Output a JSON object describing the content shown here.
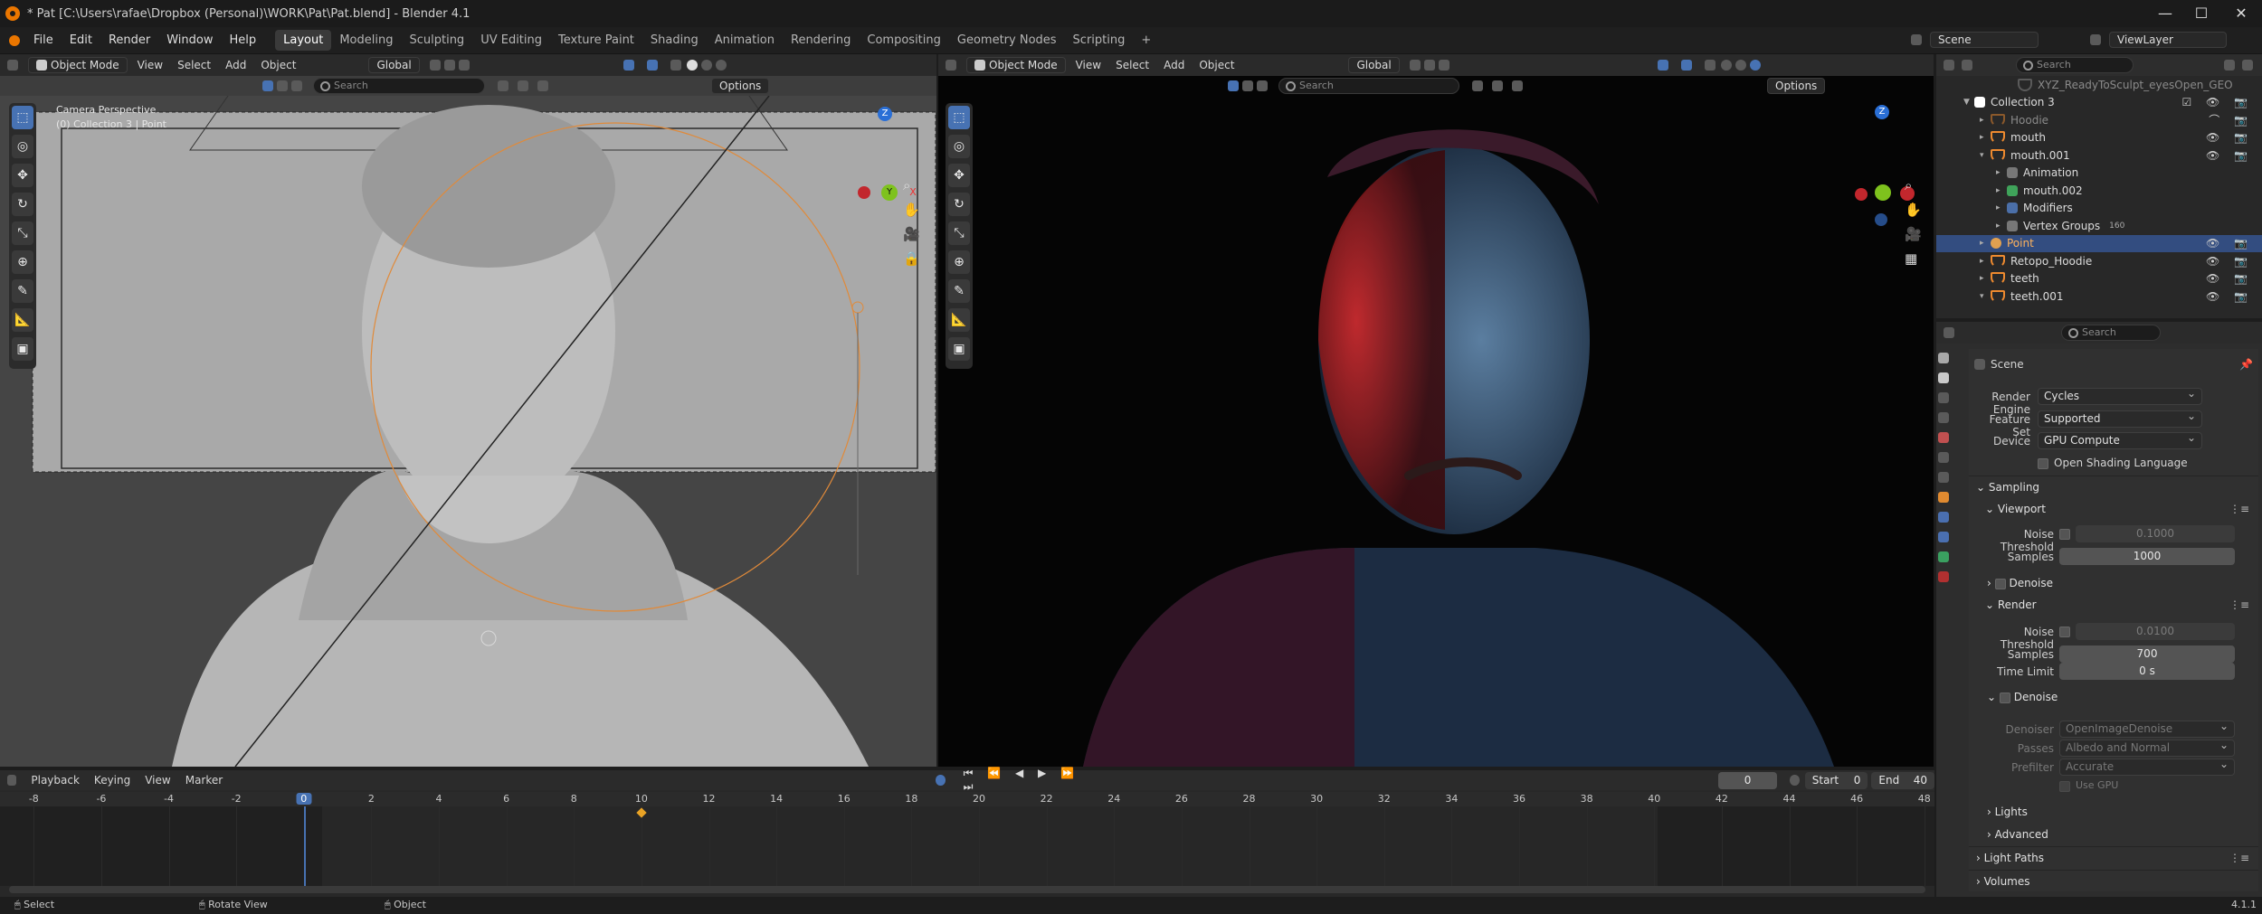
{
  "title_bar": {
    "title": "* Pat [C:\\Users\\rafae\\Dropbox (Personal)\\WORK\\Pat\\Pat.blend] - Blender 4.1",
    "minimize": "—",
    "maximize": "☐",
    "close": "✕"
  },
  "menu": [
    "File",
    "Edit",
    "Render",
    "Window",
    "Help"
  ],
  "workspaces": [
    "Layout",
    "Modeling",
    "Sculpting",
    "UV Editing",
    "Texture Paint",
    "Shading",
    "Animation",
    "Rendering",
    "Compositing",
    "Geometry Nodes",
    "Scripting"
  ],
  "active_workspace": "Layout",
  "scene": {
    "scene_name": "Scene",
    "view_layer": "ViewLayer"
  },
  "viewport_left": {
    "mode": "Object Mode",
    "menus": [
      "View",
      "Select",
      "Add",
      "Object"
    ],
    "orientation": "Global",
    "search_placeholder": "Search",
    "options": "Options",
    "overlay_line1": "Camera Perspective",
    "overlay_line2": "(0) Collection 3 | Point",
    "gizmo": {
      "z": "Z",
      "y": "Y",
      "x": "X"
    }
  },
  "viewport_right": {
    "mode": "Object Mode",
    "menus": [
      "View",
      "Select",
      "Add",
      "Object"
    ],
    "orientation": "Global",
    "search_placeholder": "Search",
    "options": "Options",
    "gizmo": {
      "z": "Z"
    }
  },
  "outliner": {
    "search_placeholder": "Search",
    "rows": [
      {
        "label": "XYZ_ReadyToSculpt_eyesOpen_GEO",
        "indent": 3,
        "dim": true
      },
      {
        "label": "Collection 3",
        "indent": 0,
        "type": "collection"
      },
      {
        "label": "Hoodie",
        "indent": 1,
        "dim": true
      },
      {
        "label": "mouth",
        "indent": 1
      },
      {
        "label": "mouth.001",
        "indent": 1,
        "expanded": true
      },
      {
        "label": "Animation",
        "indent": 2
      },
      {
        "label": "mouth.002",
        "indent": 2
      },
      {
        "label": "Modifiers",
        "indent": 2
      },
      {
        "label": "Vertex Groups",
        "indent": 2,
        "badge": "160"
      },
      {
        "label": "Point",
        "indent": 1,
        "selected": true
      },
      {
        "label": "Retopo_Hoodie",
        "indent": 1
      },
      {
        "label": "teeth",
        "indent": 1
      },
      {
        "label": "teeth.001",
        "indent": 1,
        "expanded": true
      }
    ]
  },
  "properties": {
    "search_placeholder": "Search",
    "breadcrumb": "Scene",
    "render_engine_label": "Render Engine",
    "render_engine": "Cycles",
    "feature_set_label": "Feature Set",
    "feature_set": "Supported",
    "device_label": "Device",
    "device": "GPU Compute",
    "osl_label": "Open Shading Language",
    "sampling": "Sampling",
    "viewport": "Viewport",
    "vp_noise_label": "Noise Threshold",
    "vp_noise": "0.1000",
    "vp_samples_label": "Samples",
    "vp_samples": "1000",
    "denoise": "Denoise",
    "render": "Render",
    "r_noise_label": "Noise Threshold",
    "r_noise": "0.0100",
    "r_samples_label": "Samples",
    "r_samples": "700",
    "time_limit_label": "Time Limit",
    "time_limit": "0 s",
    "denoise2": "Denoise",
    "denoiser_label": "Denoiser",
    "denoiser": "OpenImageDenoise",
    "passes_label": "Passes",
    "passes": "Albedo and Normal",
    "prefilter_label": "Prefilter",
    "prefilter": "Accurate",
    "use_gpu": "Use GPU",
    "lights": "Lights",
    "advanced": "Advanced",
    "light_paths": "Light Paths",
    "volumes": "Volumes"
  },
  "timeline": {
    "menus": [
      "Playback",
      "Keying",
      "View",
      "Marker"
    ],
    "current_frame": "0",
    "start_label": "Start",
    "start": "0",
    "end_label": "End",
    "end": "40",
    "ticks": [
      "-8",
      "-6",
      "-4",
      "-2",
      "0",
      "2",
      "4",
      "6",
      "8",
      "10",
      "12",
      "14",
      "16",
      "18",
      "20",
      "22",
      "24",
      "26",
      "28",
      "30",
      "32",
      "34",
      "36",
      "38",
      "40",
      "42",
      "44",
      "46",
      "48"
    ],
    "keyframe": "10"
  },
  "status_bar": {
    "select": "Select",
    "rotate": "Rotate View",
    "object": "Object",
    "version": "4.1.1"
  }
}
